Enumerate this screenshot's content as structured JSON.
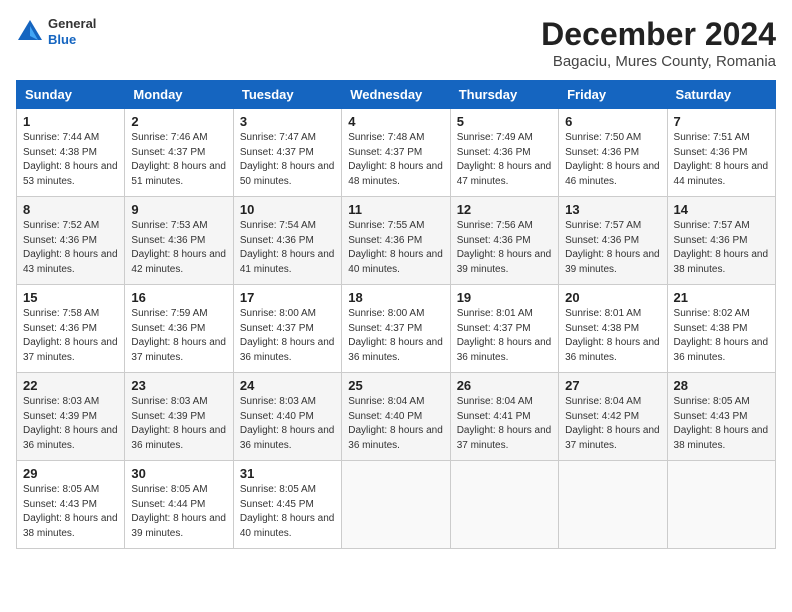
{
  "header": {
    "logo_general": "General",
    "logo_blue": "Blue",
    "month": "December 2024",
    "location": "Bagaciu, Mures County, Romania"
  },
  "weekdays": [
    "Sunday",
    "Monday",
    "Tuesday",
    "Wednesday",
    "Thursday",
    "Friday",
    "Saturday"
  ],
  "weeks": [
    [
      {
        "day": "1",
        "sunrise": "7:44 AM",
        "sunset": "4:38 PM",
        "daylight": "8 hours and 53 minutes."
      },
      {
        "day": "2",
        "sunrise": "7:46 AM",
        "sunset": "4:37 PM",
        "daylight": "8 hours and 51 minutes."
      },
      {
        "day": "3",
        "sunrise": "7:47 AM",
        "sunset": "4:37 PM",
        "daylight": "8 hours and 50 minutes."
      },
      {
        "day": "4",
        "sunrise": "7:48 AM",
        "sunset": "4:37 PM",
        "daylight": "8 hours and 48 minutes."
      },
      {
        "day": "5",
        "sunrise": "7:49 AM",
        "sunset": "4:36 PM",
        "daylight": "8 hours and 47 minutes."
      },
      {
        "day": "6",
        "sunrise": "7:50 AM",
        "sunset": "4:36 PM",
        "daylight": "8 hours and 46 minutes."
      },
      {
        "day": "7",
        "sunrise": "7:51 AM",
        "sunset": "4:36 PM",
        "daylight": "8 hours and 44 minutes."
      }
    ],
    [
      {
        "day": "8",
        "sunrise": "7:52 AM",
        "sunset": "4:36 PM",
        "daylight": "8 hours and 43 minutes."
      },
      {
        "day": "9",
        "sunrise": "7:53 AM",
        "sunset": "4:36 PM",
        "daylight": "8 hours and 42 minutes."
      },
      {
        "day": "10",
        "sunrise": "7:54 AM",
        "sunset": "4:36 PM",
        "daylight": "8 hours and 41 minutes."
      },
      {
        "day": "11",
        "sunrise": "7:55 AM",
        "sunset": "4:36 PM",
        "daylight": "8 hours and 40 minutes."
      },
      {
        "day": "12",
        "sunrise": "7:56 AM",
        "sunset": "4:36 PM",
        "daylight": "8 hours and 39 minutes."
      },
      {
        "day": "13",
        "sunrise": "7:57 AM",
        "sunset": "4:36 PM",
        "daylight": "8 hours and 39 minutes."
      },
      {
        "day": "14",
        "sunrise": "7:57 AM",
        "sunset": "4:36 PM",
        "daylight": "8 hours and 38 minutes."
      }
    ],
    [
      {
        "day": "15",
        "sunrise": "7:58 AM",
        "sunset": "4:36 PM",
        "daylight": "8 hours and 37 minutes."
      },
      {
        "day": "16",
        "sunrise": "7:59 AM",
        "sunset": "4:36 PM",
        "daylight": "8 hours and 37 minutes."
      },
      {
        "day": "17",
        "sunrise": "8:00 AM",
        "sunset": "4:37 PM",
        "daylight": "8 hours and 36 minutes."
      },
      {
        "day": "18",
        "sunrise": "8:00 AM",
        "sunset": "4:37 PM",
        "daylight": "8 hours and 36 minutes."
      },
      {
        "day": "19",
        "sunrise": "8:01 AM",
        "sunset": "4:37 PM",
        "daylight": "8 hours and 36 minutes."
      },
      {
        "day": "20",
        "sunrise": "8:01 AM",
        "sunset": "4:38 PM",
        "daylight": "8 hours and 36 minutes."
      },
      {
        "day": "21",
        "sunrise": "8:02 AM",
        "sunset": "4:38 PM",
        "daylight": "8 hours and 36 minutes."
      }
    ],
    [
      {
        "day": "22",
        "sunrise": "8:03 AM",
        "sunset": "4:39 PM",
        "daylight": "8 hours and 36 minutes."
      },
      {
        "day": "23",
        "sunrise": "8:03 AM",
        "sunset": "4:39 PM",
        "daylight": "8 hours and 36 minutes."
      },
      {
        "day": "24",
        "sunrise": "8:03 AM",
        "sunset": "4:40 PM",
        "daylight": "8 hours and 36 minutes."
      },
      {
        "day": "25",
        "sunrise": "8:04 AM",
        "sunset": "4:40 PM",
        "daylight": "8 hours and 36 minutes."
      },
      {
        "day": "26",
        "sunrise": "8:04 AM",
        "sunset": "4:41 PM",
        "daylight": "8 hours and 37 minutes."
      },
      {
        "day": "27",
        "sunrise": "8:04 AM",
        "sunset": "4:42 PM",
        "daylight": "8 hours and 37 minutes."
      },
      {
        "day": "28",
        "sunrise": "8:05 AM",
        "sunset": "4:43 PM",
        "daylight": "8 hours and 38 minutes."
      }
    ],
    [
      {
        "day": "29",
        "sunrise": "8:05 AM",
        "sunset": "4:43 PM",
        "daylight": "8 hours and 38 minutes."
      },
      {
        "day": "30",
        "sunrise": "8:05 AM",
        "sunset": "4:44 PM",
        "daylight": "8 hours and 39 minutes."
      },
      {
        "day": "31",
        "sunrise": "8:05 AM",
        "sunset": "4:45 PM",
        "daylight": "8 hours and 40 minutes."
      },
      null,
      null,
      null,
      null
    ]
  ]
}
